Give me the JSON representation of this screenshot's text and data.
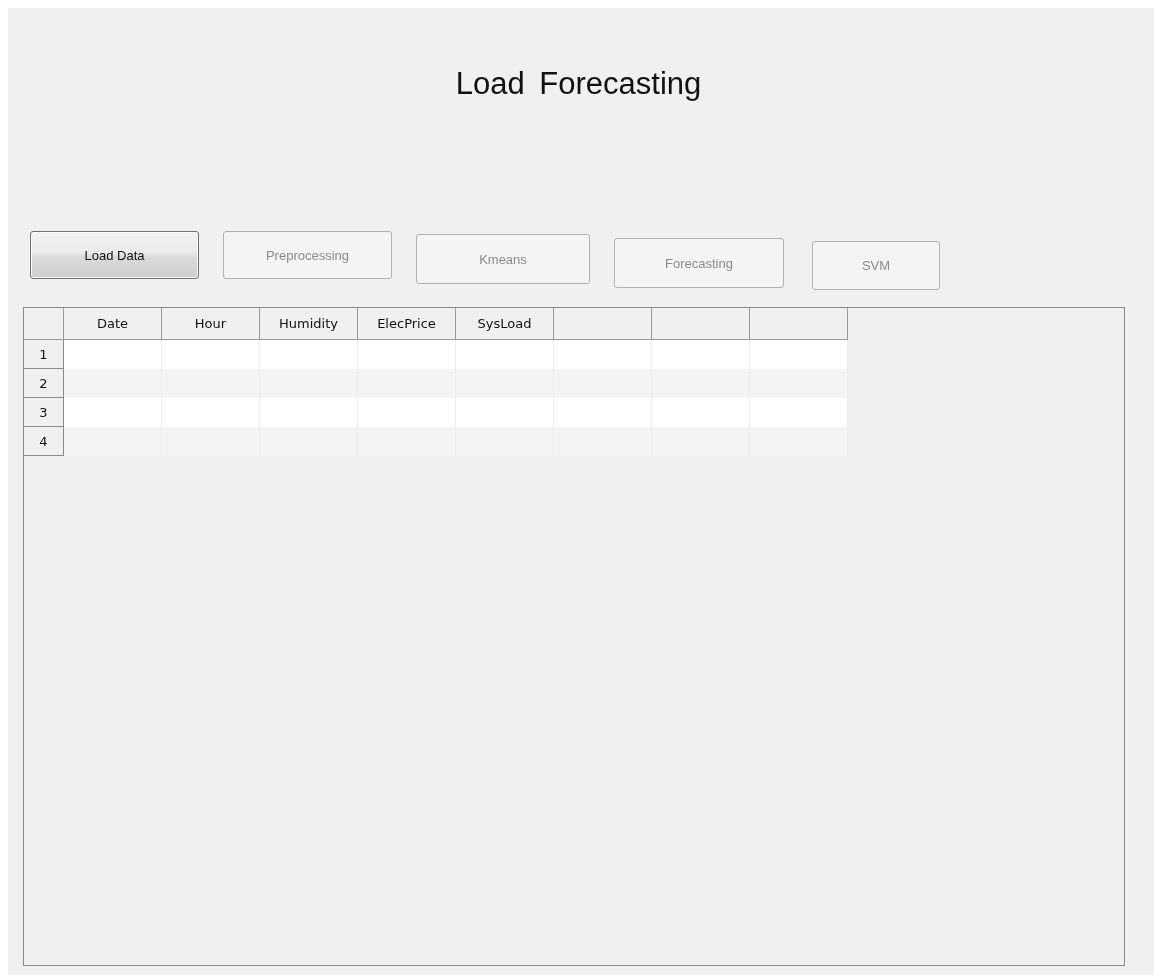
{
  "title": "Load Forecasting",
  "buttons": [
    {
      "label": "Load Data",
      "disabled": false
    },
    {
      "label": "Preprocessing",
      "disabled": true
    },
    {
      "label": "Kmeans",
      "disabled": true
    },
    {
      "label": "Forecasting",
      "disabled": true
    },
    {
      "label": "SVM",
      "disabled": true
    }
  ],
  "table": {
    "columns": [
      {
        "label": "Date"
      },
      {
        "label": "Hour"
      },
      {
        "label": "Humidity"
      },
      {
        "label": "ElecPrice"
      },
      {
        "label": "SysLoad"
      },
      {},
      {},
      {}
    ],
    "rows": [
      {
        "header": "1"
      },
      {
        "header": "2"
      },
      {
        "header": "3"
      },
      {
        "header": "4"
      }
    ]
  }
}
